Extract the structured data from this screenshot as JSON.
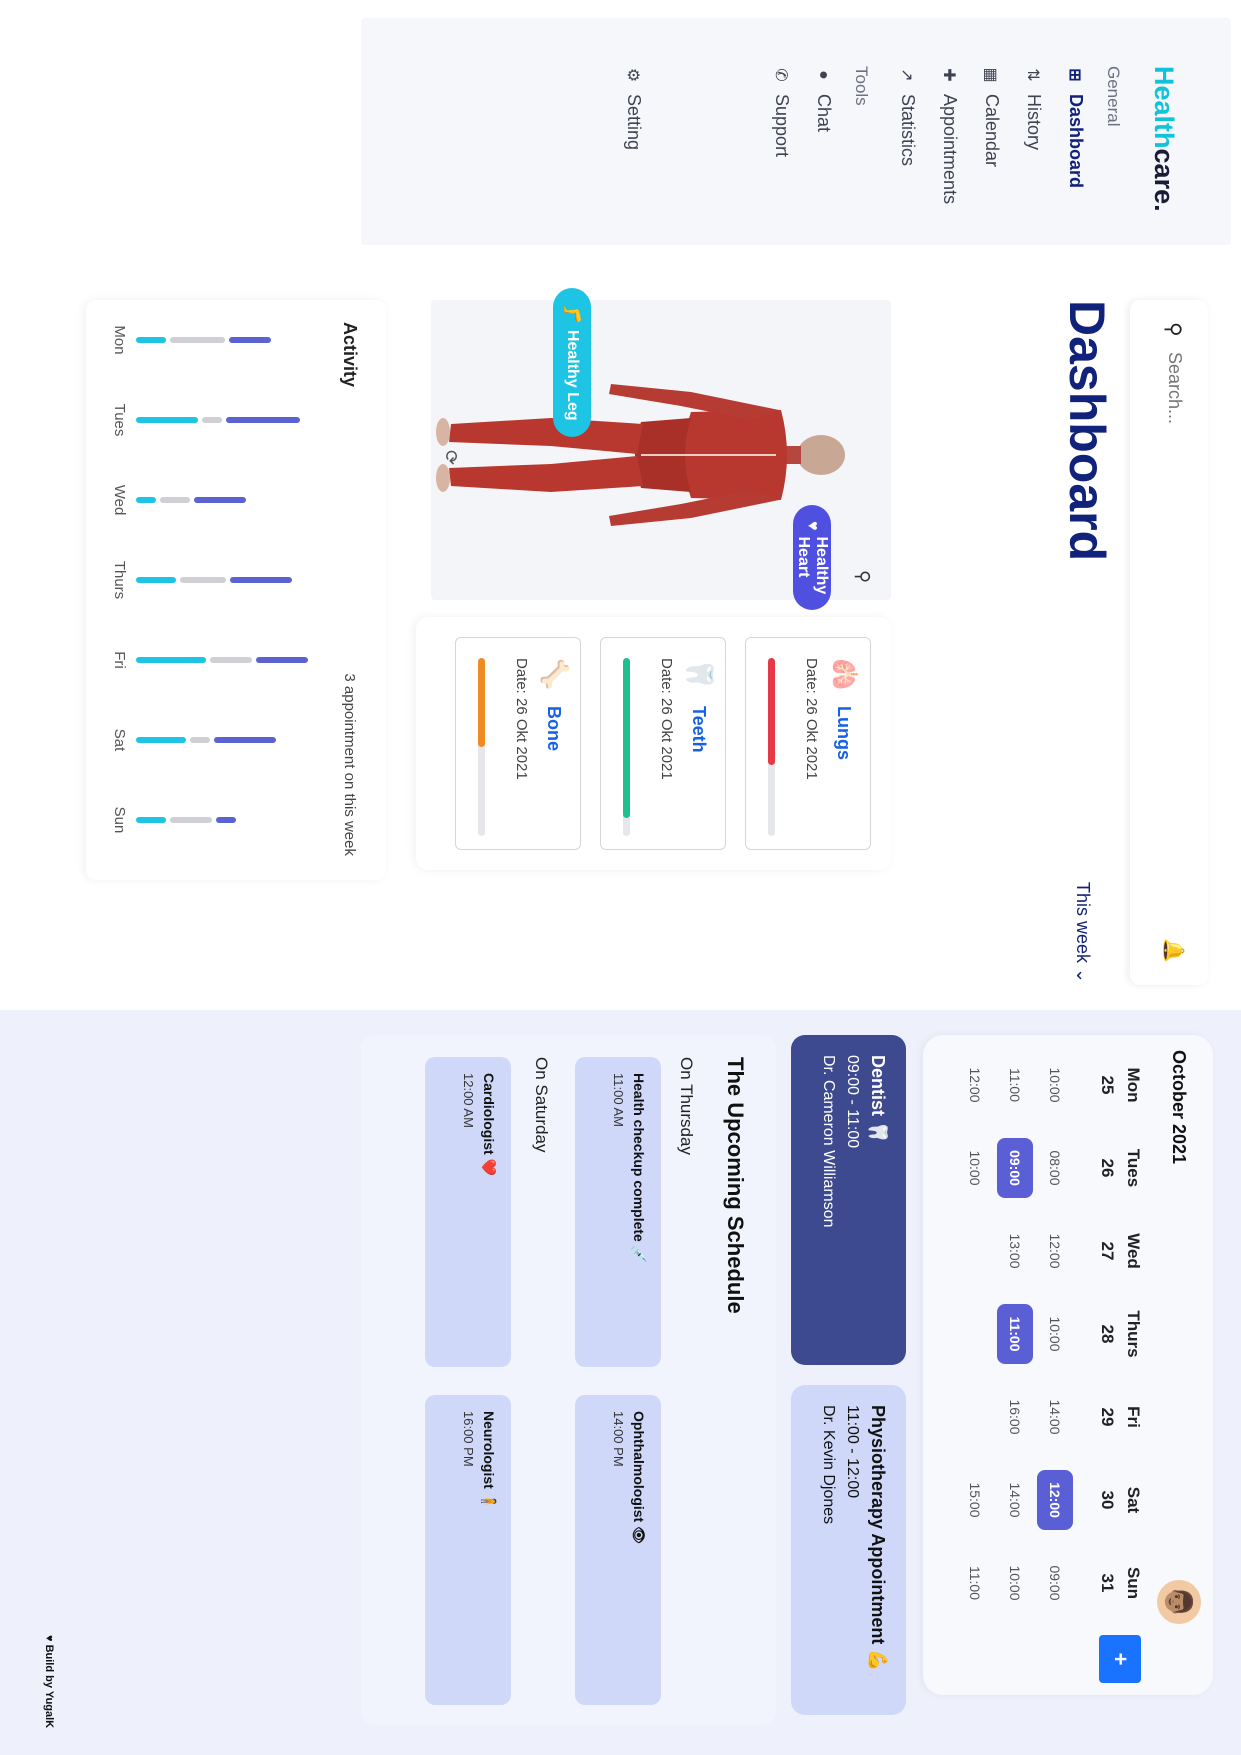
{
  "logo": {
    "part1": "Health",
    "part2": "care."
  },
  "sidebar": {
    "general_label": "General",
    "tools_label": "Tools",
    "items": [
      {
        "label": "Dashboard",
        "icon": "grid-icon"
      },
      {
        "label": "History",
        "icon": "swap-icon"
      },
      {
        "label": "Calendar",
        "icon": "calendar-icon"
      },
      {
        "label": "Appointments",
        "icon": "medkit-icon"
      },
      {
        "label": "Statistics",
        "icon": "chart-icon"
      },
      {
        "label": "Chat",
        "icon": "chat-icon"
      },
      {
        "label": "Support",
        "icon": "phone-icon"
      },
      {
        "label": "Setting",
        "icon": "gear-icon"
      }
    ]
  },
  "search": {
    "placeholder": "Search..."
  },
  "page_title": "Dashboard",
  "period": "This week",
  "badges": {
    "heart": "Healthy Heart",
    "leg": "Healthy Leg"
  },
  "organs": [
    {
      "name": "Lungs",
      "date": "Date: 26 Okt 2021",
      "progress": 0.6,
      "color": "#e53945",
      "icon": "🫁"
    },
    {
      "name": "Teeth",
      "date": "Date: 26 Okt 2021",
      "progress": 0.9,
      "color": "#1fbf8f",
      "icon": "🦷"
    },
    {
      "name": "Bone",
      "date": "Date: 26 Okt 2021",
      "progress": 0.5,
      "color": "#f08a24",
      "icon": "🦴"
    }
  ],
  "activity": {
    "title": "Activity",
    "subtitle": "3 appointment on this week",
    "days": [
      "Mon",
      "Tues",
      "Wed",
      "Thurs",
      "Fri",
      "Sat",
      "Sun"
    ],
    "series": [
      {
        "color": "#1ec4e4",
        "values": [
          30,
          62,
          20,
          40,
          70,
          50,
          30
        ]
      },
      {
        "color": "#cfd0d3",
        "values": [
          55,
          20,
          30,
          46,
          42,
          20,
          42
        ]
      },
      {
        "color": "#5b63d3",
        "values": [
          42,
          74,
          52,
          62,
          52,
          62,
          20
        ]
      }
    ]
  },
  "calendar": {
    "month": "October 2021",
    "days": [
      {
        "name": "Mon",
        "date": "25",
        "times": [
          "10:00",
          "11:00",
          "12:00"
        ],
        "selected": -1
      },
      {
        "name": "Tues",
        "date": "26",
        "times": [
          "08:00",
          "09:00",
          "10:00"
        ],
        "selected": 1
      },
      {
        "name": "Wed",
        "date": "27",
        "times": [
          "12:00",
          "13:00",
          ""
        ],
        "selected": -1
      },
      {
        "name": "Thurs",
        "date": "28",
        "times": [
          "10:00",
          "11:00",
          ""
        ],
        "selected": 1
      },
      {
        "name": "Fri",
        "date": "29",
        "times": [
          "14:00",
          "16:00",
          ""
        ],
        "selected": -1
      },
      {
        "name": "Sat",
        "date": "30",
        "times": [
          "12:00",
          "14:00",
          "15:00"
        ],
        "selected": 0
      },
      {
        "name": "Sun",
        "date": "31",
        "times": [
          "09:00",
          "10:00",
          "11:00"
        ],
        "selected": -1
      }
    ]
  },
  "appointments": [
    {
      "title": "Dentist 🦷",
      "time": "09:00 - 11:00",
      "doctor": "Dr. Cameron Williamson"
    },
    {
      "title": "Physiotherapy Appointment 💪",
      "time": "11:00 - 12:00",
      "doctor": "Dr. Kevin Djones"
    }
  ],
  "schedule": {
    "title": "The Upcoming Schedule",
    "groups": [
      {
        "label": "On Thursday",
        "items": [
          {
            "title": "Health checkup complete 💉",
            "time": "11:00 AM"
          },
          {
            "title": "Ophthalmologist 👁",
            "time": "14:00 PM"
          }
        ]
      },
      {
        "label": "On Saturday",
        "items": [
          {
            "title": "Cardiologist ❤️",
            "time": "12:00 AM"
          },
          {
            "title": "Neurologist 🧍",
            "time": "16:00 PM"
          }
        ]
      }
    ]
  },
  "credit": "♥ Build by YugalK"
}
